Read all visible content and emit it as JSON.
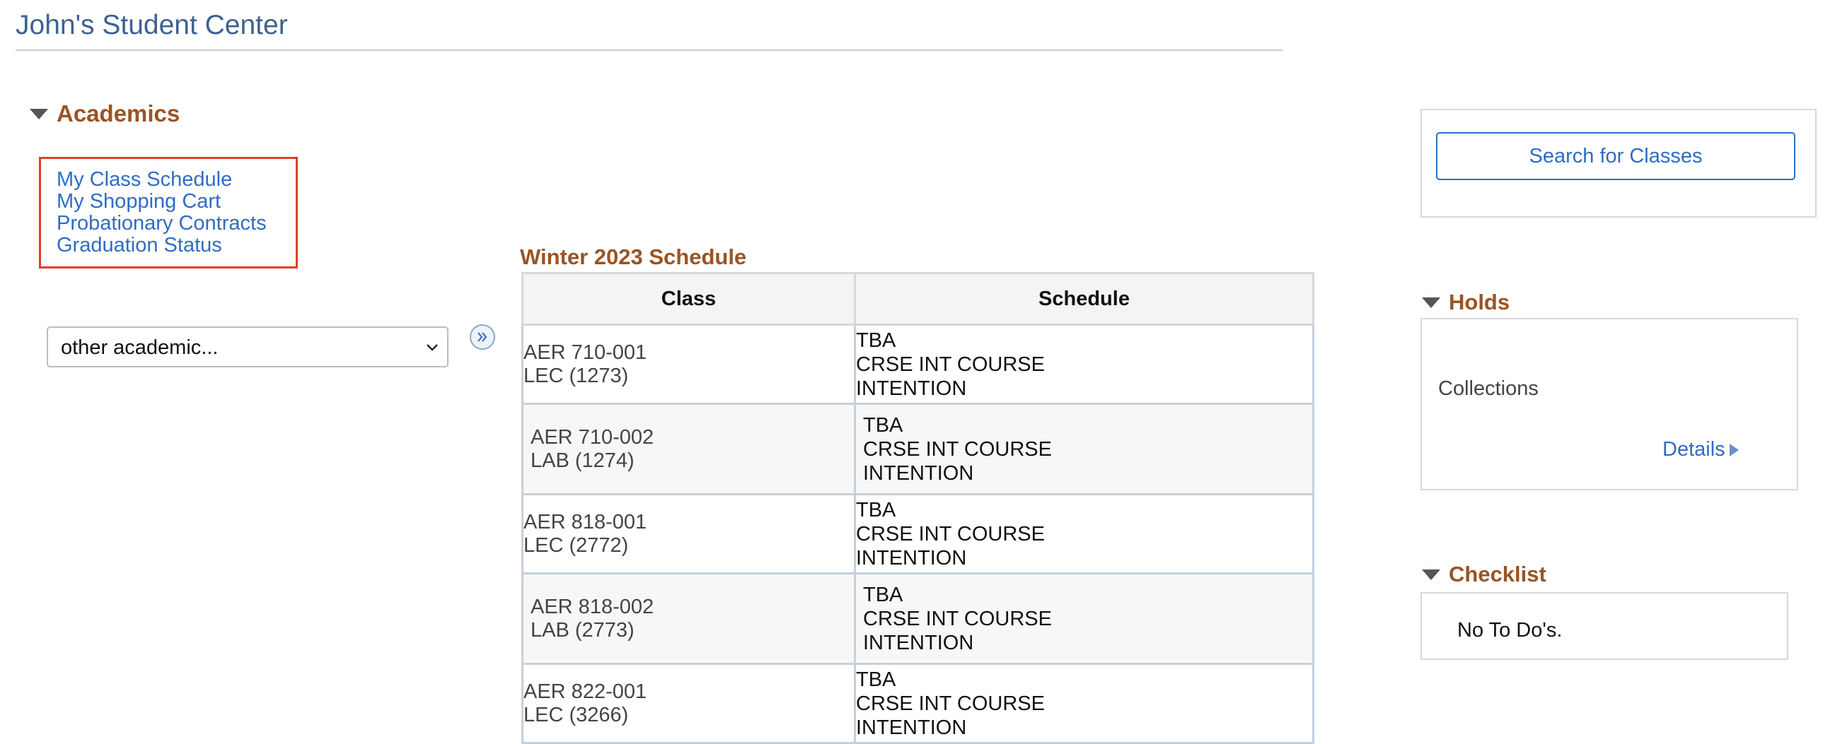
{
  "page": {
    "title": "John's Student Center"
  },
  "academics": {
    "heading": "Academics",
    "links": [
      "My Class Schedule",
      "My Shopping Cart",
      "Probationary Contracts",
      "Graduation Status"
    ],
    "select": {
      "value": "other academic..."
    },
    "go_icon": "double-chevron-right-icon"
  },
  "schedule": {
    "title": "Winter 2023 Schedule",
    "columns": [
      "Class",
      "Schedule"
    ],
    "rows": [
      {
        "class": [
          "AER 710-001",
          "LEC (1273)"
        ],
        "schedule": [
          "TBA",
          "CRSE INT COURSE",
          "INTENTION"
        ]
      },
      {
        "class": [
          "AER 710-002",
          "LAB (1274)"
        ],
        "schedule": [
          "TBA",
          "CRSE INT COURSE",
          "INTENTION"
        ]
      },
      {
        "class": [
          "AER 818-001",
          "LEC (2772)"
        ],
        "schedule": [
          "TBA",
          "CRSE INT COURSE",
          "INTENTION"
        ]
      },
      {
        "class": [
          "AER 818-002",
          "LAB (2773)"
        ],
        "schedule": [
          "TBA",
          "CRSE INT COURSE",
          "INTENTION"
        ]
      },
      {
        "class": [
          "AER 822-001",
          "LEC (3266)"
        ],
        "schedule": [
          "TBA",
          "CRSE INT COURSE",
          "INTENTION"
        ]
      }
    ]
  },
  "search": {
    "button_label": "Search for Classes"
  },
  "holds": {
    "heading": "Holds",
    "item": "Collections",
    "details_label": "Details"
  },
  "checklist": {
    "heading": "Checklist",
    "empty_text": "No To Do's."
  },
  "colors": {
    "title": "#3d6291",
    "section_heading": "#9a5424",
    "link": "#2f6cc4",
    "highlight_border": "#e23d2b"
  }
}
